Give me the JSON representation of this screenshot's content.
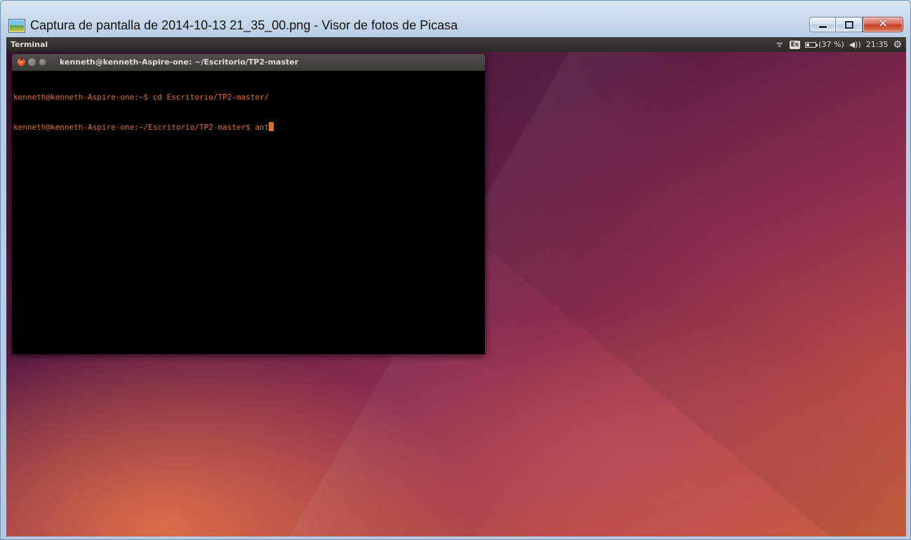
{
  "window": {
    "title": "Captura de pantalla de 2014-10-13 21_35_00.png - Visor de fotos de Picasa",
    "app_icon": "picasa-photo-icon",
    "controls": {
      "minimize": "minimize-icon",
      "maximize": "maximize-icon",
      "close": "✕"
    }
  },
  "screenshot": {
    "top_panel": {
      "app_name": "Terminal",
      "indicators": {
        "wifi_icon": "ᯤ",
        "keyboard_layout": "Es",
        "battery_percent": "(37 %)",
        "battery_level": 0.37,
        "volume_icon": "◀))",
        "clock": "21:35",
        "settings_icon": "⚙"
      }
    },
    "terminal": {
      "title": "kenneth@kenneth-Aspire-one: ~/Escritorio/TP2-master",
      "close_glyph": "x",
      "lines": [
        "kenneth@kenneth-Aspire-one:~$ cd Escritorio/TP2-master/",
        "kenneth@kenneth-Aspire-one:~/Escritorio/TP2-master$ ant"
      ]
    },
    "colors": {
      "terminal_text": "#e0701e",
      "panel_bg": "#3c3b37",
      "desktop_purple": "#5c1d44",
      "desktop_orange": "#c9603f"
    }
  }
}
